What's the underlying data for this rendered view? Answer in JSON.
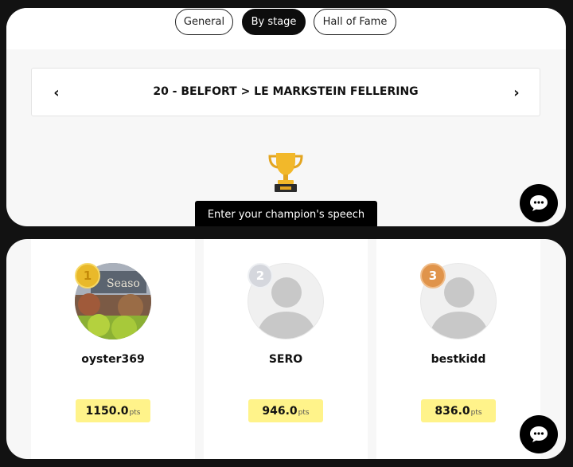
{
  "tabs": {
    "general": "General",
    "by_stage": "By stage",
    "hall_of_fame": "Hall of Fame"
  },
  "stage": {
    "title": "20 - BELFORT > LE MARKSTEIN FELLERING",
    "prev_icon": "‹",
    "next_icon": "›"
  },
  "champion": {
    "speech_label": "Enter your champion's speech"
  },
  "leaderboard": [
    {
      "rank": "1",
      "username": "oyster369",
      "points": "1150.0",
      "unit": "pts",
      "medal": "gold"
    },
    {
      "rank": "2",
      "username": "SERO",
      "points": "946.0",
      "unit": "pts",
      "medal": "silver"
    },
    {
      "rank": "3",
      "username": "bestkidd",
      "points": "836.0",
      "unit": "pts",
      "medal": "bronze"
    }
  ],
  "colors": {
    "active_tab": "#0d0d0d",
    "points_badge": "#fff38a",
    "gold": "#e9b92a",
    "silver": "#d5d7dd",
    "bronze": "#e0944b"
  }
}
